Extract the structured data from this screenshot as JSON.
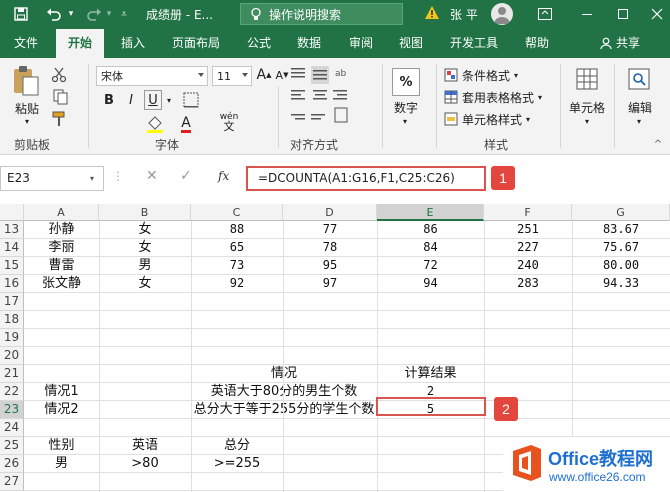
{
  "titlebar": {
    "doc_title": "成绩册 - E...",
    "search_placeholder": "操作说明搜索",
    "user_name": "张 平"
  },
  "tabs": [
    "文件",
    "开始",
    "插入",
    "页面布局",
    "公式",
    "数据",
    "审阅",
    "视图",
    "开发工具",
    "帮助"
  ],
  "share_label": "共享",
  "ribbon": {
    "paste_label": "粘贴",
    "clipboard_label": "剪贴板",
    "font_name": "宋体",
    "font_size": "11",
    "bold": "B",
    "italic": "I",
    "underline": "U",
    "font_label": "字体",
    "increase_font": "A",
    "decrease_font": "A",
    "font_color_letter": "A",
    "phonetic": "wén",
    "align_label": "对齐方式",
    "number_label": "数字",
    "number_symbol": "%",
    "conditional_format": "条件格式",
    "table_format": "套用表格格式",
    "cell_style": "单元格样式",
    "styles_label": "样式",
    "cells_label": "单元格",
    "edit_label": "编辑"
  },
  "formula_bar": {
    "name_box": "E23",
    "fx": "fx",
    "formula": "=DCOUNTA(A1:G16,F1,C25:C26)"
  },
  "badges": [
    "1",
    "2"
  ],
  "columns": [
    "A",
    "B",
    "C",
    "D",
    "E",
    "F",
    "G"
  ],
  "rows": [
    {
      "num": "13",
      "A": "孙静",
      "B": "女",
      "C": "88",
      "D": "77",
      "E": "86",
      "F": "251",
      "G": "83.67"
    },
    {
      "num": "14",
      "A": "李丽",
      "B": "女",
      "C": "65",
      "D": "78",
      "E": "84",
      "F": "227",
      "G": "75.67"
    },
    {
      "num": "15",
      "A": "曹雷",
      "B": "男",
      "C": "73",
      "D": "95",
      "E": "72",
      "F": "240",
      "G": "80.00"
    },
    {
      "num": "16",
      "A": "张文静",
      "B": "女",
      "C": "92",
      "D": "97",
      "E": "94",
      "F": "283",
      "G": "94.33"
    },
    {
      "num": "17"
    },
    {
      "num": "18"
    },
    {
      "num": "19"
    },
    {
      "num": "20"
    },
    {
      "num": "21",
      "C": "情况",
      "E": "计算结果"
    },
    {
      "num": "22",
      "A": "情况1",
      "C": "英语大于80分的男生个数",
      "E": "2"
    },
    {
      "num": "23",
      "A": "情况2",
      "C": "总分大于等于255分的学生个数",
      "E": "5"
    },
    {
      "num": "24"
    },
    {
      "num": "25",
      "A": "性别",
      "B": "英语",
      "C": "总分"
    },
    {
      "num": "26",
      "A": "男",
      "B": ">80",
      "C": ">=255"
    },
    {
      "num": "27"
    }
  ],
  "watermark": {
    "title": "Office教程网",
    "url": "www.office26.com"
  },
  "colors": {
    "excel_green": "#217346",
    "highlight_red": "#d9534f",
    "badge_red": "#e2463d",
    "watermark_blue": "#1f6fd1",
    "watermark_orange": "#e8521f"
  }
}
